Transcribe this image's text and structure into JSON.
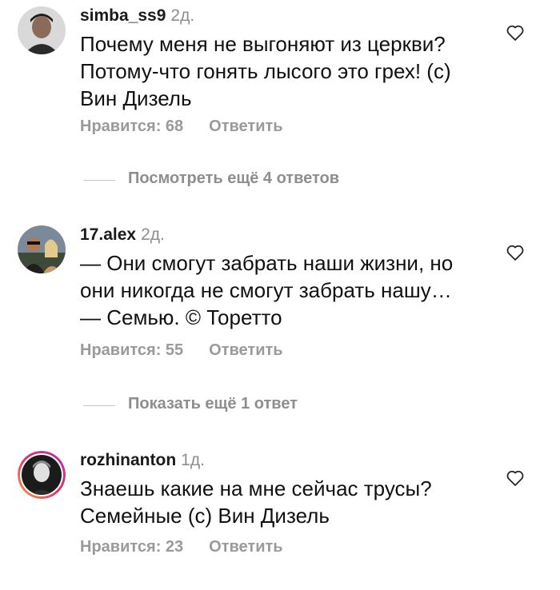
{
  "comments": [
    {
      "username": "simba_ss9",
      "time": "2д.",
      "lines": [
        "Почему меня не выгоняют из церкви?",
        "Потому-что гонять лысого это грех! (с)",
        "Вин Дизель"
      ],
      "likes": "Нравится: 68",
      "reply": "Ответить"
    },
    {
      "username": "17.alex",
      "time": "2д.",
      "lines": [
        "— Они смогут забрать наши жизни, но",
        "они никогда не смогут забрать нашу…",
        "— Семью. © Торетто"
      ],
      "likes": "Нравится: 55",
      "reply": "Ответить"
    },
    {
      "username": "rozhinanton",
      "time": "1д.",
      "lines": [
        "Знаешь какие на мне сейчас трусы?",
        "Семейные (с) Вин Дизель"
      ],
      "likes": "Нравится: 23",
      "reply": "Ответить"
    }
  ],
  "view_more": [
    "Посмотреть ещё 4 ответов",
    "Показать ещё 1 ответ"
  ],
  "colors": {
    "text": "#111111",
    "muted": "#8e8e8e",
    "story_ring": [
      "#f9a23a",
      "#e1306c",
      "#b22fb5"
    ]
  },
  "icons": {
    "like": "heart-outline-icon"
  }
}
